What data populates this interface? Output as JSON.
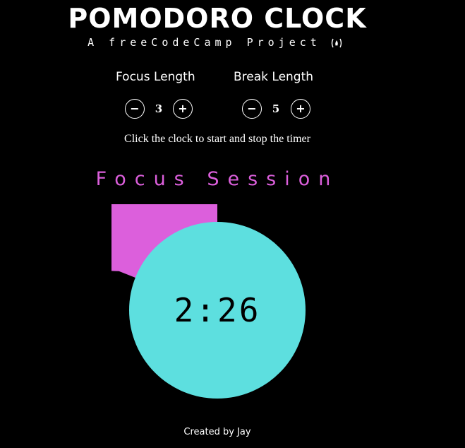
{
  "header": {
    "title": "POMODORO CLOCK",
    "subtitle": "A freeCodeCamp Project"
  },
  "settings": {
    "focus": {
      "label": "Focus Length",
      "value": "3",
      "decrement": "−",
      "increment": "+"
    },
    "break": {
      "label": "Break Length",
      "value": "5",
      "decrement": "−",
      "increment": "+"
    }
  },
  "instructions": "Click the clock to start and stop the timer",
  "timer": {
    "session_label": "Focus Session",
    "time": "2:26",
    "progress_fraction": 0.81,
    "colors": {
      "ring": "#dc5fdc",
      "face": "#5ddfdf",
      "background": "#000000"
    }
  },
  "footer": {
    "credit": "Created by Jay"
  },
  "icons": {
    "fcc": "fire-icon"
  }
}
